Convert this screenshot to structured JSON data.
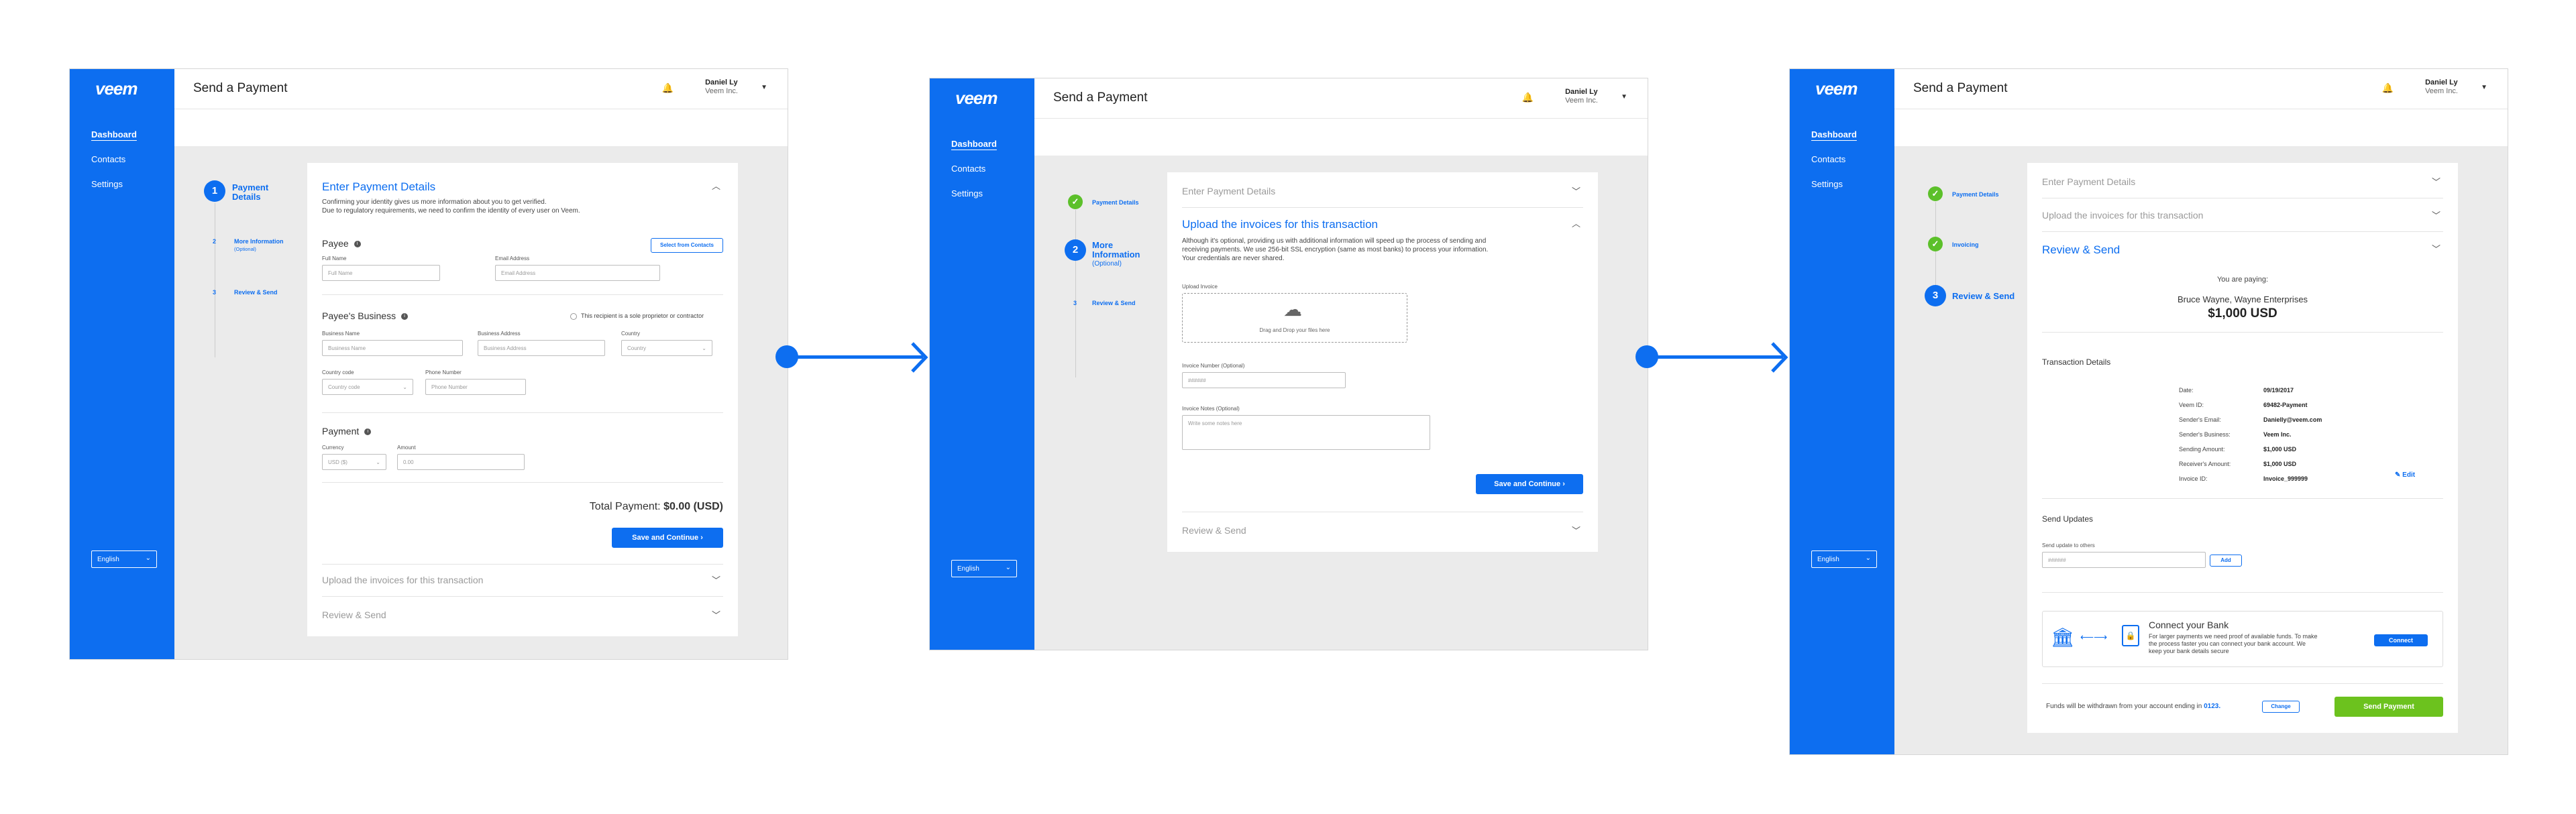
{
  "common": {
    "logo": "veem",
    "nav": [
      "Dashboard",
      "Contacts",
      "Settings"
    ],
    "language": "English",
    "page_title": "Send a Payment",
    "user_name": "Daniel Ly",
    "user_company": "Veem Inc."
  },
  "screen1": {
    "steps": [
      {
        "num": "1",
        "label": "Payment Details"
      },
      {
        "num": "2",
        "label": "More Information",
        "sub": "(Optional)"
      },
      {
        "num": "3",
        "label": "Review & Send"
      }
    ],
    "heading": "Enter Payment Details",
    "intro1": "Confirming your identity gives us more information about you to get verified.",
    "intro2": "Due to regulatory requirements, we need to confirm the identity of every user on Veem.",
    "payee_title": "Payee",
    "select_contacts": "Select from Contacts",
    "full_name_label": "Full Name",
    "full_name_ph": "Full Name",
    "email_label": "Email Address",
    "email_ph": "Email Address",
    "business_title": "Payee's Business",
    "sole_prop": "This recipient is a sole proprietor or contractor",
    "biz_name_label": "Business Name",
    "biz_name_ph": "Business Name",
    "biz_addr_label": "Business Address",
    "biz_addr_ph": "Business Address",
    "country_label": "Country",
    "country_ph": "Country",
    "country_code_label": "Country code",
    "country_code_ph": "Country code",
    "phone_label": "Phone Number",
    "phone_ph": "Phone Number",
    "payment_title": "Payment",
    "currency_label": "Currency",
    "currency_val": "USD ($)",
    "amount_label": "Amount",
    "amount_ph": "0.00",
    "total_label": "Total Payment:",
    "total_value": "$0.00 (USD)",
    "save_btn": "Save and Continue",
    "collapsed1": "Upload the invoices for this transaction",
    "collapsed2": "Review & Send"
  },
  "screen2": {
    "steps": [
      {
        "label": "Payment Details"
      },
      {
        "num": "2",
        "label": "More Information",
        "sub": "(Optional)"
      },
      {
        "num": "3",
        "label": "Review & Send"
      }
    ],
    "collapsed_top": "Enter Payment Details",
    "heading": "Upload the invoices for this transaction",
    "intro1": "Although it's optional, providing us with additional information will speed up the process of sending and",
    "intro2": "receiving payments. We use 256-bit SSL encryption (same as most banks) to process your information.",
    "intro3": "Your credentials are never shared.",
    "upload_label": "Upload Invoice",
    "drop_text": "Drag and Drop your files here",
    "inv_num_label": "Invoice Number (Optional)",
    "inv_num_ph": "######",
    "inv_notes_label": "Invoice Notes (Optional)",
    "inv_notes_ph": "Write some notes here",
    "save_btn": "Save and Continue",
    "collapsed_bottom": "Review & Send"
  },
  "screen3": {
    "steps": [
      {
        "label": "Payment Details"
      },
      {
        "label": "Invoicing"
      },
      {
        "num": "3",
        "label": "Review & Send"
      }
    ],
    "collapsed1": "Enter Payment Details",
    "collapsed2": "Upload the invoices for this transaction",
    "heading": "Review & Send",
    "paying_label": "You are paying:",
    "payee_name": "Bruce Wayne, Wayne Enterprises",
    "amount": "$1,000 USD",
    "tx_title": "Transaction Details",
    "details": [
      {
        "k": "Date:",
        "v": "09/19/2017"
      },
      {
        "k": "Veem ID:",
        "v": "69482-Payment"
      },
      {
        "k": "Sender's Email:",
        "v": "Danielly@veem.com"
      },
      {
        "k": "Sender's Business:",
        "v": "Veem Inc."
      },
      {
        "k": "Sending Amount:",
        "v": "$1,000 USD"
      },
      {
        "k": "Receiver's Amount:",
        "v": "$1,000 USD"
      },
      {
        "k": "Invoice ID:",
        "v": "Invoice_999999"
      }
    ],
    "edit": "Edit",
    "updates_title": "Send Updates",
    "updates_label": "Send update to others",
    "updates_ph": "######",
    "add_btn": "Add",
    "bank_title": "Connect your Bank",
    "bank_text1": "For larger payments we need proof of available funds. To make",
    "bank_text2": "the process faster you can connect your bank account. We",
    "bank_text3": "keep your bank details secure",
    "connect_btn": "Connect",
    "funds_text": "Funds will be withdrawn from your account ending in",
    "account_end": "0123.",
    "change_btn": "Change",
    "send_btn": "Send Payment",
    "send_color": "#6cc21e"
  },
  "colors": {
    "accent": "#0d6ef0",
    "check": "#5cc02a"
  }
}
